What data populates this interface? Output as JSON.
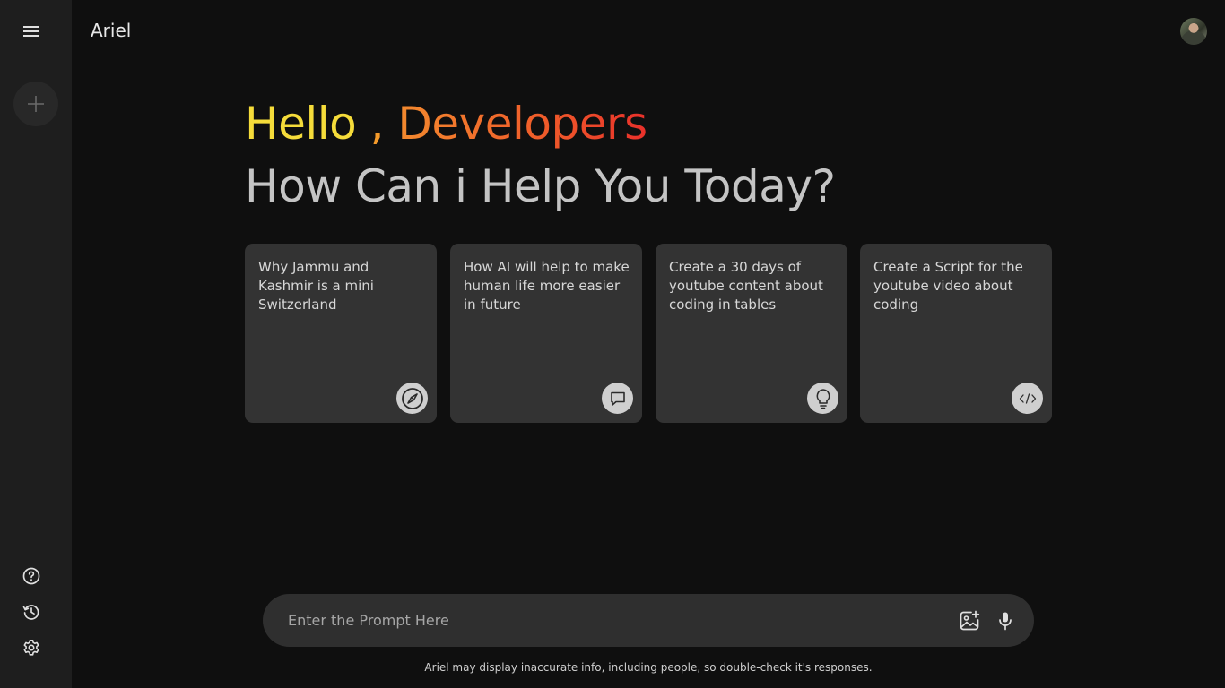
{
  "app": {
    "title": "Ariel"
  },
  "sidebar": {
    "menu_icon": "menu-icon",
    "new_chat_icon": "plus-icon",
    "bottom_items": [
      {
        "icon": "help-icon"
      },
      {
        "icon": "history-icon"
      },
      {
        "icon": "settings-icon"
      }
    ]
  },
  "greeting": {
    "hello": "Hello",
    "comma": " , ",
    "name": "Developers",
    "subtitle": "How Can i Help You Today?"
  },
  "cards": [
    {
      "text": "Why Jammu and Kashmir is a mini Switzerland",
      "icon": "compass-icon"
    },
    {
      "text": "How AI will help to make human life more easier in future",
      "icon": "chat-bubble-icon"
    },
    {
      "text": "Create a 30 days of youtube content about coding in tables",
      "icon": "bulb-icon"
    },
    {
      "text": "Create a Script for the youtube video about coding",
      "icon": "code-icon"
    }
  ],
  "prompt": {
    "placeholder": "Enter the Prompt Here",
    "value": ""
  },
  "disclaimer": "Ariel may display inaccurate info, including people, so double-check it's responses.",
  "colors": {
    "background": "#0f0f0f",
    "sidebar": "#1e1e1e",
    "card": "#333333",
    "hello": "#f5dc3a",
    "name_gradient_start": "#f38a2e",
    "name_gradient_end": "#e9302a"
  }
}
